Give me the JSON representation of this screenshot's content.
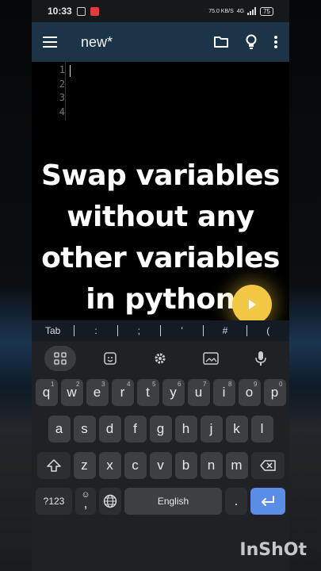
{
  "status": {
    "time": "10:33",
    "speed": "75.0 KB/S",
    "network": "4G",
    "battery": "75"
  },
  "appbar": {
    "title": "new*"
  },
  "editor": {
    "line_numbers": [
      "1",
      "2",
      "3",
      "4"
    ]
  },
  "overlay": {
    "lines": [
      "Swap variables",
      "without any",
      "other variables",
      "in python"
    ]
  },
  "extra_keys": [
    "Tab",
    ":",
    ";",
    "'",
    "#",
    "("
  ],
  "keyboard": {
    "row1": [
      {
        "k": "q",
        "s": "1"
      },
      {
        "k": "w",
        "s": "2"
      },
      {
        "k": "e",
        "s": "3"
      },
      {
        "k": "r",
        "s": "4"
      },
      {
        "k": "t",
        "s": "5"
      },
      {
        "k": "y",
        "s": "6"
      },
      {
        "k": "u",
        "s": "7"
      },
      {
        "k": "i",
        "s": "8"
      },
      {
        "k": "o",
        "s": "9"
      },
      {
        "k": "p",
        "s": "0"
      }
    ],
    "row2": [
      "a",
      "s",
      "d",
      "f",
      "g",
      "h",
      "j",
      "k",
      "l"
    ],
    "row3": [
      "z",
      "x",
      "c",
      "v",
      "b",
      "n",
      "m"
    ],
    "symbols_label": "?123",
    "emoji_label": "☺",
    "comma_label": ",",
    "space_label": "English",
    "period_label": "."
  },
  "watermark": "InShOt",
  "colors": {
    "appbar": "#1b3448",
    "enter_key": "#5a8ee6",
    "play_button": "#f1c743"
  }
}
